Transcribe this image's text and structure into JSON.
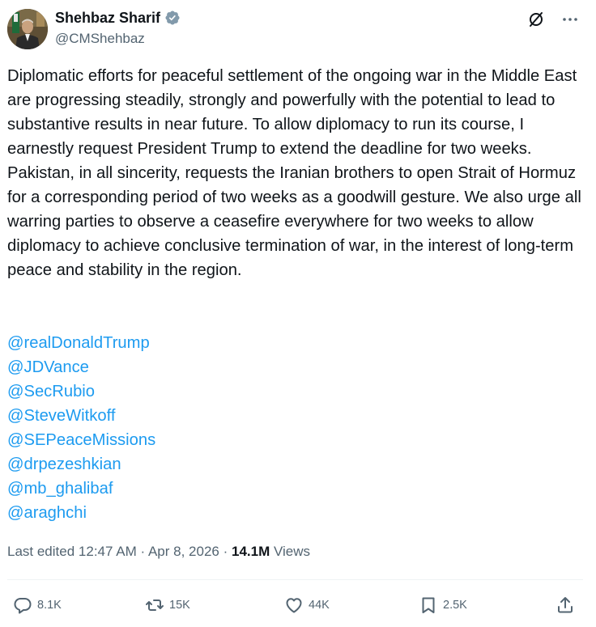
{
  "author": {
    "display_name": "Shehbaz Sharif",
    "handle": "@CMShehbaz",
    "verified": true
  },
  "icons": {
    "verified": "verified-badge-icon",
    "grok": "grok-icon",
    "more": "more-icon",
    "reply": "reply-icon",
    "repost": "repost-icon",
    "like": "like-icon",
    "bookmark": "bookmark-icon",
    "share": "share-icon"
  },
  "colors": {
    "text": "#0f1419",
    "secondary": "#536471",
    "link": "#1d9bf0",
    "verified": "#829aab"
  },
  "tweet": {
    "text": "Diplomatic efforts for peaceful settlement of the ongoing war in the Middle East are progressing steadily, strongly and powerfully with the potential to lead to substantive results in near future. To allow diplomacy to run its course, I earnestly request President Trump to extend the deadline for two weeks. Pakistan, in all sincerity, requests the Iranian brothers to open Strait of Hormuz for a corresponding period of two weeks as a goodwill gesture. We also urge all warring parties to observe a ceasefire everywhere for two weeks to allow diplomacy to achieve conclusive termination of war, in the interest of long-term peace and stability in the region.",
    "mentions": [
      "@realDonaldTrump",
      "@JDVance",
      "@SecRubio",
      "@SteveWitkoff",
      "@SEPeaceMissions",
      "@drpezeshkian",
      "@mb_ghalibaf",
      "@araghchi"
    ]
  },
  "meta": {
    "edited": "Last edited",
    "time": "12:47 AM",
    "separator": "·",
    "date": "Apr 8, 2026",
    "views_count": "14.1M",
    "views_label": "Views"
  },
  "actions": {
    "replies": "8.1K",
    "reposts": "15K",
    "likes": "44K",
    "bookmarks": "2.5K"
  }
}
